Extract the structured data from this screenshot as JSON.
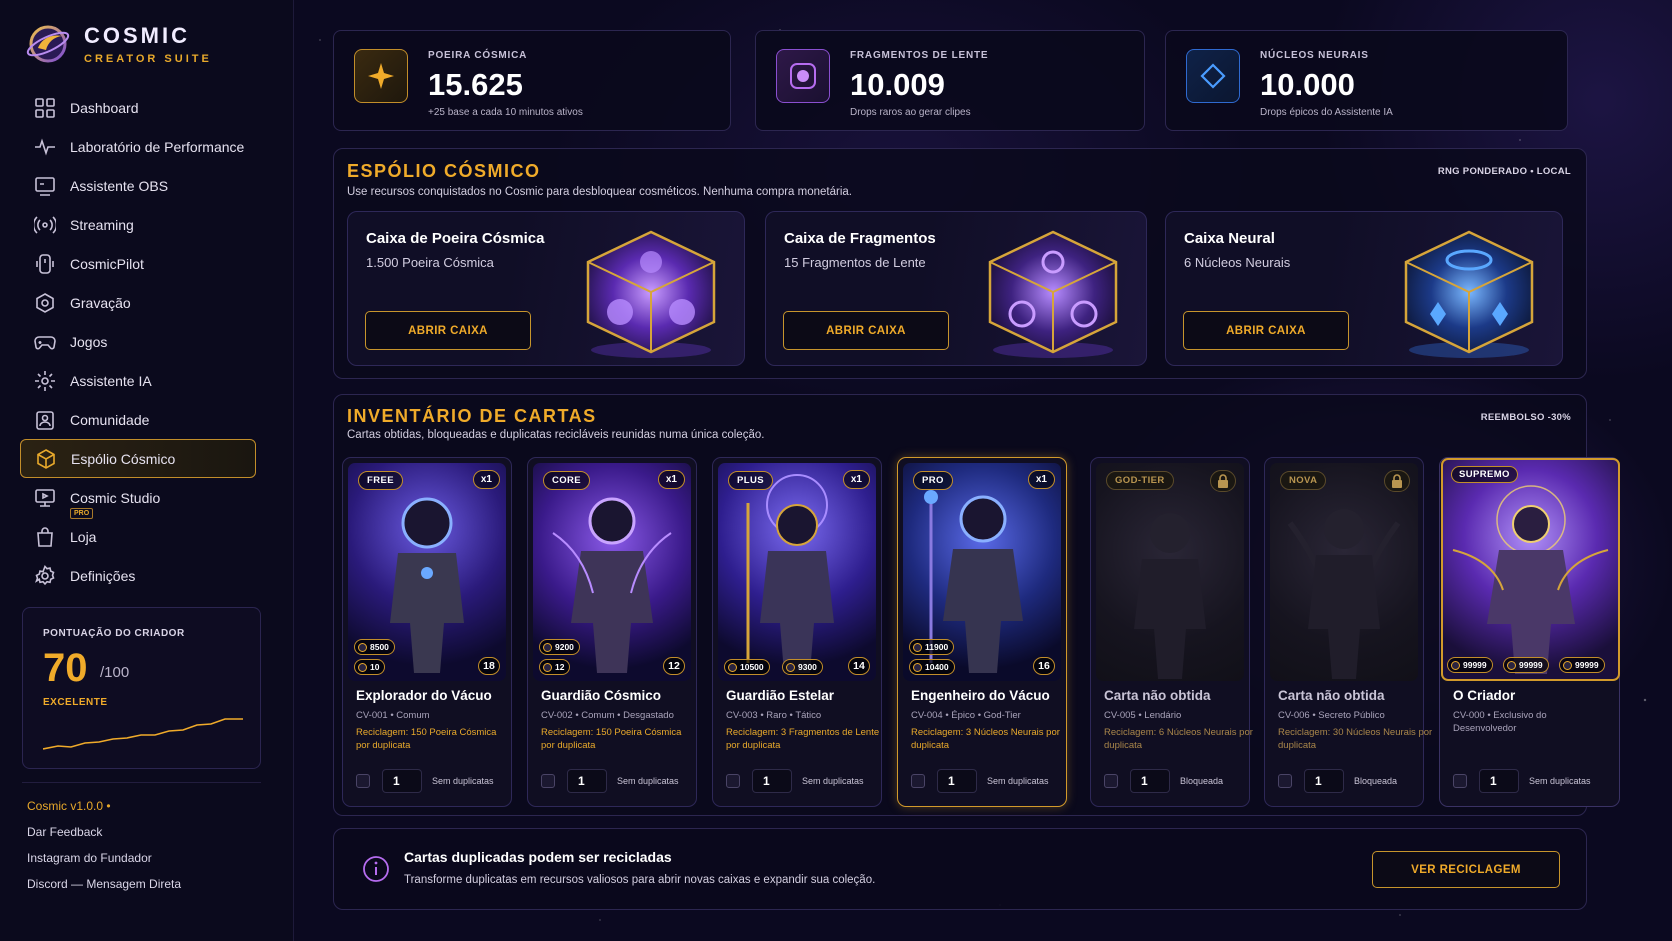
{
  "brand": {
    "title": "COSMIC",
    "subtitle": "CREATOR SUITE"
  },
  "nav": [
    {
      "label": "Dashboard",
      "icon": "grid-icon"
    },
    {
      "label": "Laboratório de Performance",
      "icon": "pulse-icon"
    },
    {
      "label": "Assistente OBS",
      "icon": "monitor-icon"
    },
    {
      "label": "Streaming",
      "icon": "broadcast-icon"
    },
    {
      "label": "CosmicPilot",
      "icon": "controller-icon"
    },
    {
      "label": "Gravação",
      "icon": "record-icon"
    },
    {
      "label": "Jogos",
      "icon": "gamepad-icon"
    },
    {
      "label": "Assistente IA",
      "icon": "sparkle-icon"
    },
    {
      "label": "Comunidade",
      "icon": "community-icon"
    },
    {
      "label": "Espólio Cósmico",
      "icon": "cube-icon",
      "active": true
    },
    {
      "label": "Cosmic Studio",
      "icon": "studio-icon",
      "badge": "PRO"
    },
    {
      "label": "Loja",
      "icon": "bag-icon"
    },
    {
      "label": "Definições",
      "icon": "gear-icon"
    }
  ],
  "score": {
    "label": "PONTUAÇÃO DO CRIADOR",
    "value": "70",
    "max": "/100",
    "rating": "EXCELENTE"
  },
  "footer": {
    "version": "Cosmic v1.0.0 •",
    "links": [
      "Dar Feedback",
      "Instagram do Fundador",
      "Discord — Mensagem Direta"
    ]
  },
  "stats": [
    {
      "label": "POEIRA CÓSMICA",
      "value": "15.625",
      "sub": "+25 base a cada 10 minutos ativos",
      "icon": "star-icon",
      "color": "#f0ab2a"
    },
    {
      "label": "FRAGMENTOS DE LENTE",
      "value": "10.009",
      "sub": "Drops raros ao gerar clipes",
      "icon": "lens-icon",
      "color": "#b66cf0"
    },
    {
      "label": "NÚCLEOS NEURAIS",
      "value": "10.000",
      "sub": "Drops épicos do Assistente IA",
      "icon": "diamond-icon",
      "color": "#3b8cf0"
    }
  ],
  "loot": {
    "title": "ESPÓLIO CÓSMICO",
    "subtitle": "Use recursos conquistados no Cosmic para desbloquear cosméticos. Nenhuma compra monetária.",
    "tag": "RNG PONDERADO • LOCAL",
    "boxes": [
      {
        "title": "Caixa de Poeira Cósmica",
        "cost": "1.500 Poeira Cósmica",
        "button": "ABRIR CAIXA",
        "glow": "#b36cff"
      },
      {
        "title": "Caixa de Fragmentos",
        "cost": "15 Fragmentos de Lente",
        "button": "ABRIR CAIXA",
        "glow": "#a66cff"
      },
      {
        "title": "Caixa Neural",
        "cost": "6 Núcleos Neurais",
        "button": "ABRIR CAIXA",
        "glow": "#3f8cff"
      }
    ]
  },
  "inventory": {
    "title": "INVENTÁRIO DE CARTAS",
    "subtitle": "Cartas obtidas, bloqueadas e duplicatas recicláveis reunidas numa única coleção.",
    "tag": "REEMBOLSO -30%",
    "cards": [
      {
        "tier": "FREE",
        "count": "x1",
        "name": "Explorador do Vácuo",
        "meta": "CV-001 • Comum",
        "recycle": "Reciclagem: 150 Poeira Cósmica por duplicata",
        "qty": "1",
        "status": "Sem duplicatas",
        "stats": [
          "8500",
          "10"
        ],
        "level": "18"
      },
      {
        "tier": "CORE",
        "count": "x1",
        "name": "Guardião Cósmico",
        "meta": "CV-002 • Comum • Desgastado",
        "recycle": "Reciclagem: 150 Poeira Cósmica por duplicata",
        "qty": "1",
        "status": "Sem duplicatas",
        "stats": [
          "9200",
          "12"
        ],
        "level": "12"
      },
      {
        "tier": "PLUS",
        "count": "x1",
        "name": "Guardião Estelar",
        "meta": "CV-003 • Raro • Tático",
        "recycle": "Reciclagem: 3 Fragmentos de Lente por duplicata",
        "qty": "1",
        "status": "Sem duplicatas",
        "stats": [
          "10500",
          "9300"
        ],
        "level": "14"
      },
      {
        "tier": "PRO",
        "count": "x1",
        "name": "Engenheiro do Vácuo",
        "meta": "CV-004 • Épico • God-Tier",
        "recycle": "Reciclagem: 3 Núcleos Neurais por duplicata",
        "qty": "1",
        "status": "Sem duplicatas",
        "stats": [
          "11900",
          "10400"
        ],
        "level": "16"
      },
      {
        "tier": "GOD-TIER",
        "name": "Carta não obtida",
        "meta": "CV-005 • Lendário",
        "recycle": "Reciclagem: 6 Núcleos Neurais por duplicata",
        "qty": "1",
        "status": "Bloqueada"
      },
      {
        "tier": "NOVA",
        "name": "Carta não obtida",
        "meta": "CV-006 • Secreto Público",
        "recycle": "Reciclagem: 30 Núcleos Neurais por duplicata",
        "qty": "1",
        "status": "Bloqueada"
      },
      {
        "tier": "SUPREMO",
        "name": "O Criador",
        "meta": "CV-000 • Exclusivo do Desenvolvedor",
        "qty": "1",
        "status": "Sem duplicatas",
        "stats": [
          "99999",
          "99999",
          "99999"
        ]
      }
    ]
  },
  "info": {
    "title": "Cartas duplicadas podem ser recicladas",
    "subtitle": "Transforme duplicatas em recursos valiosos para abrir novas caixas e expandir sua coleção.",
    "button": "VER RECICLAGEM"
  }
}
